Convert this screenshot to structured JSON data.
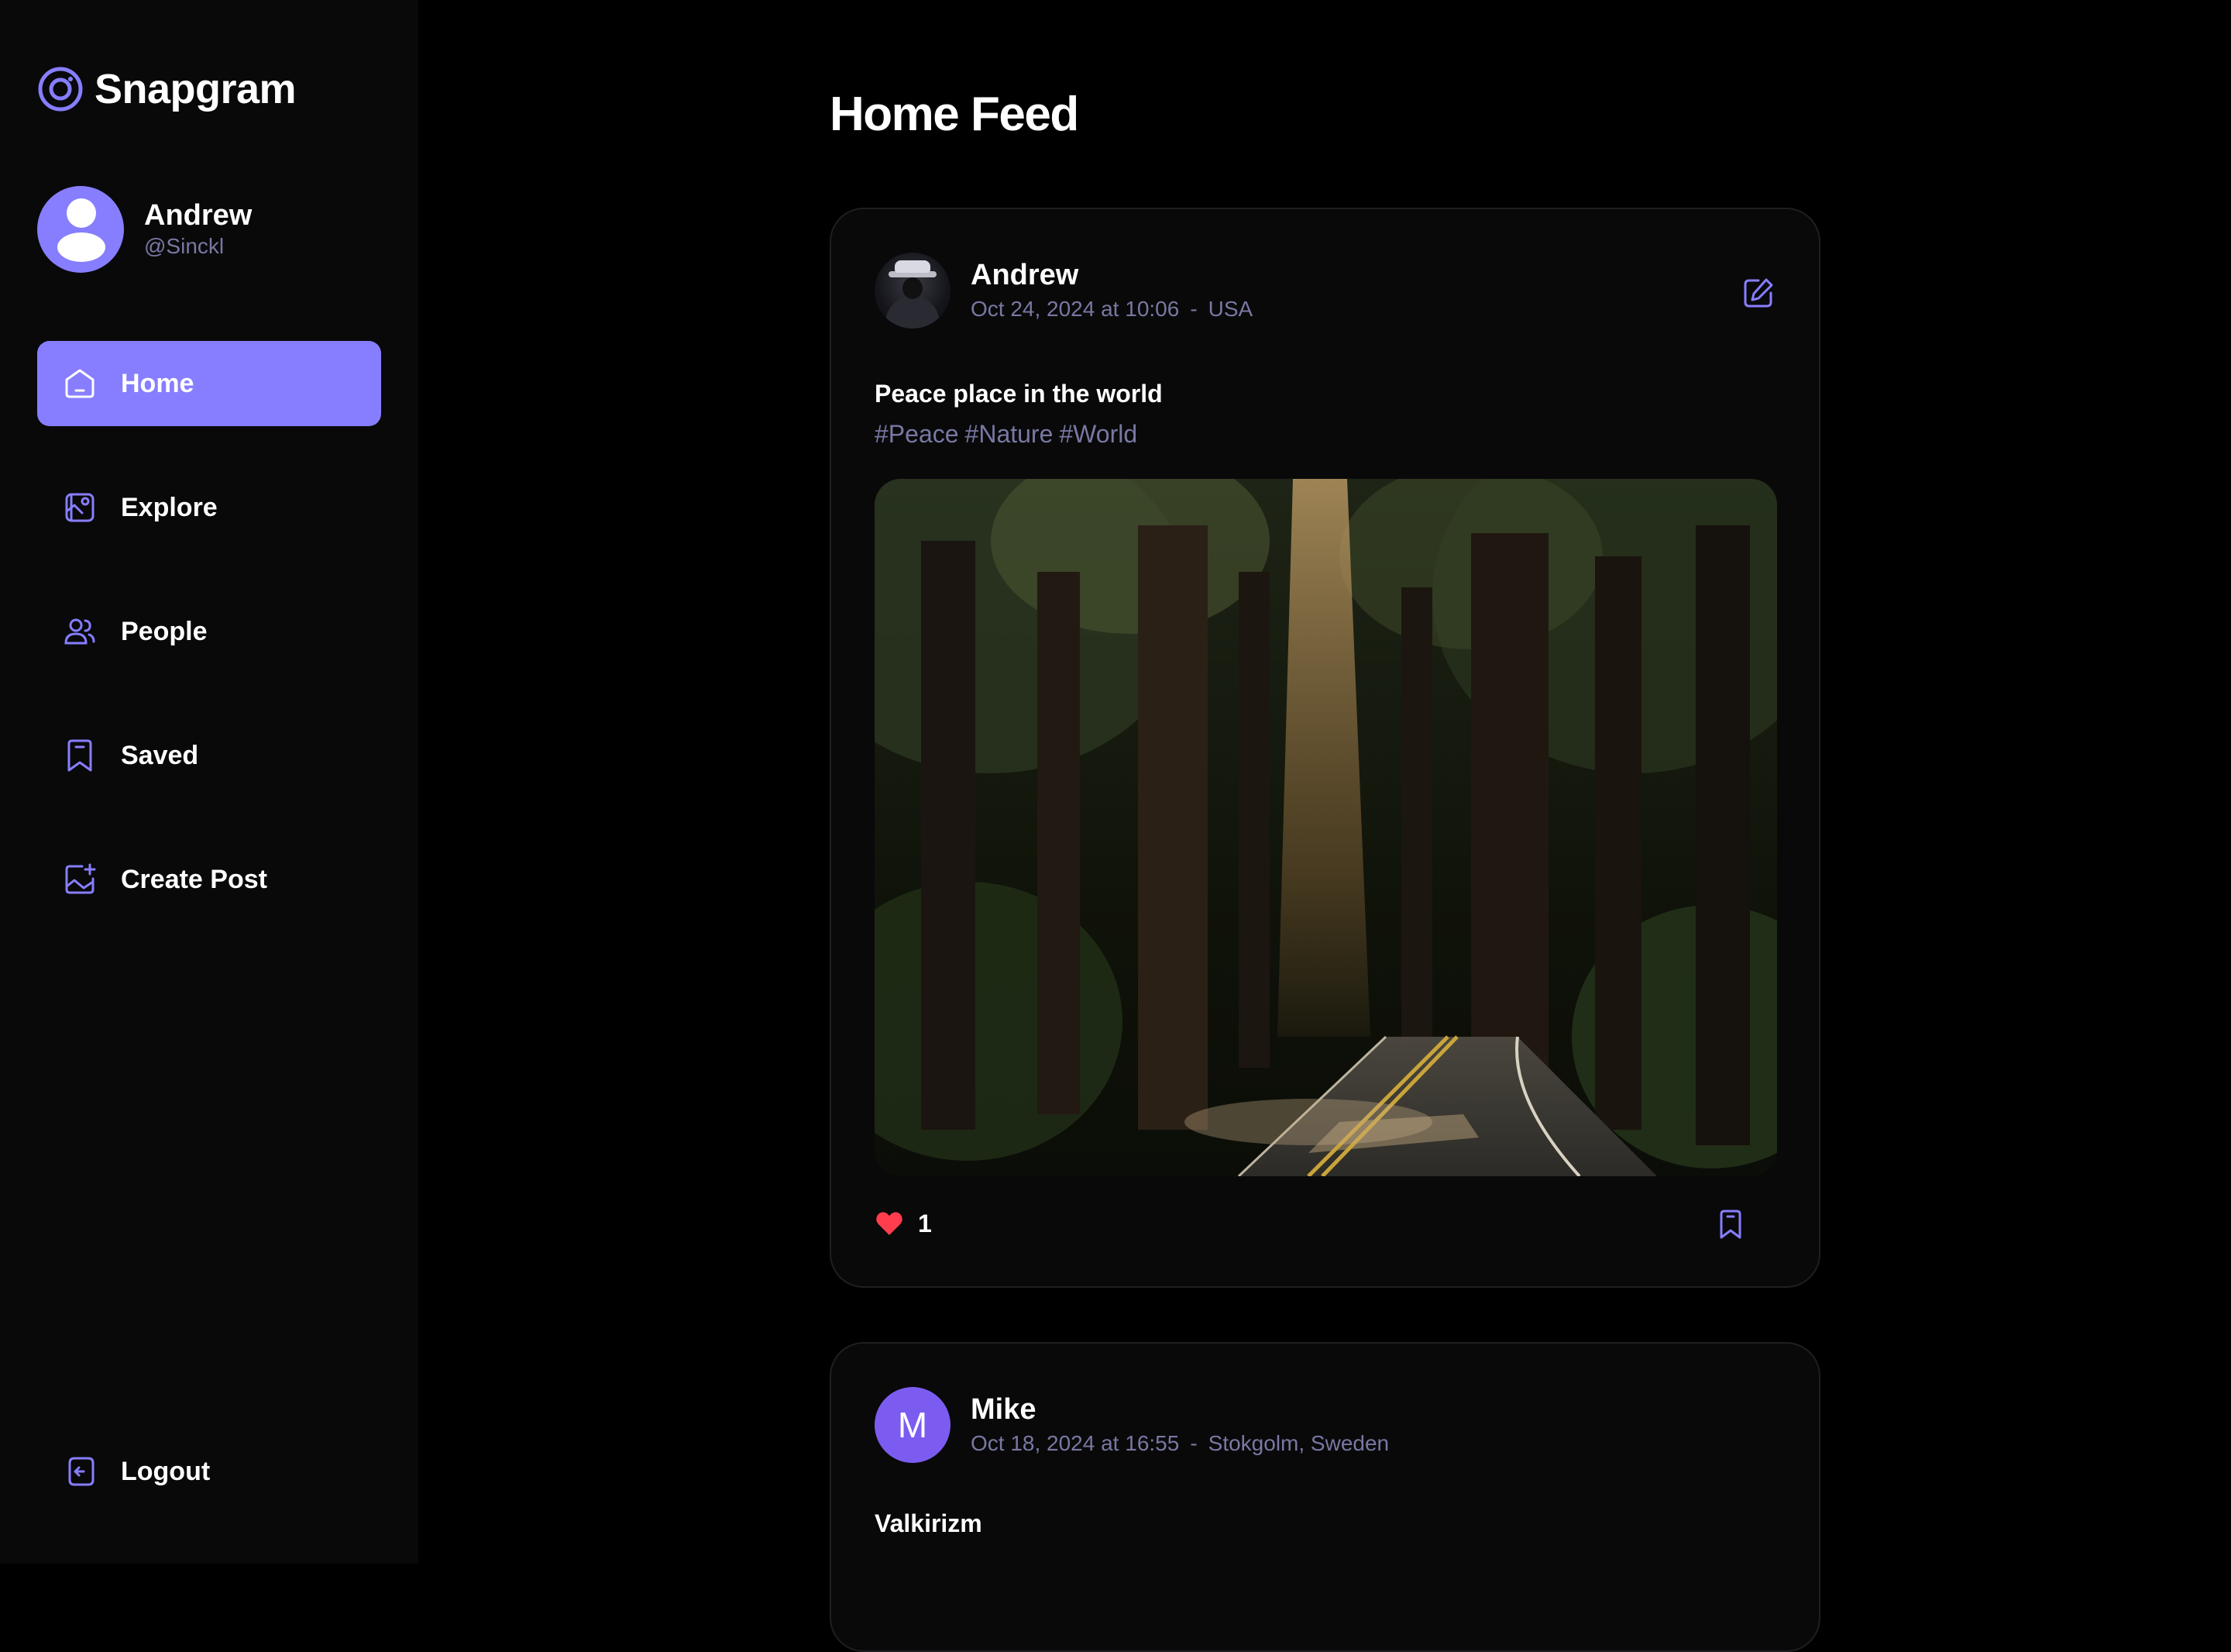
{
  "app": {
    "name": "Snapgram"
  },
  "user": {
    "name": "Andrew",
    "handle": "@Sinckl"
  },
  "nav": {
    "items": [
      {
        "label": "Home",
        "icon": "home-icon",
        "active": true
      },
      {
        "label": "Explore",
        "icon": "explore-icon",
        "active": false
      },
      {
        "label": "People",
        "icon": "people-icon",
        "active": false
      },
      {
        "label": "Saved",
        "icon": "bookmark-icon",
        "active": false
      },
      {
        "label": "Create Post",
        "icon": "create-post-icon",
        "active": false
      }
    ],
    "logout": "Logout"
  },
  "page": {
    "title": "Home Feed"
  },
  "posts": [
    {
      "author": "Andrew",
      "date": "Oct 24, 2024 at 10:06",
      "separator": "-",
      "location": "USA",
      "caption": "Peace place in the world",
      "tags": [
        "#Peace",
        "#Nature",
        "#World"
      ],
      "likes": "1",
      "avatar_icon": "user-photo-avatar"
    },
    {
      "author": "Mike",
      "avatar_letter": "M",
      "date": "Oct 18, 2024 at 16:55",
      "separator": "-",
      "location": "Stokgolm, Sweden",
      "caption": "Valkirizm"
    }
  ],
  "colors": {
    "accent": "#877eff",
    "secondary_text": "#7878a3",
    "sidebar_bg": "#09090a",
    "card_bg": "#09090a",
    "like_red": "#ff3d4d",
    "avatar_purple": "#7c5cf0"
  }
}
